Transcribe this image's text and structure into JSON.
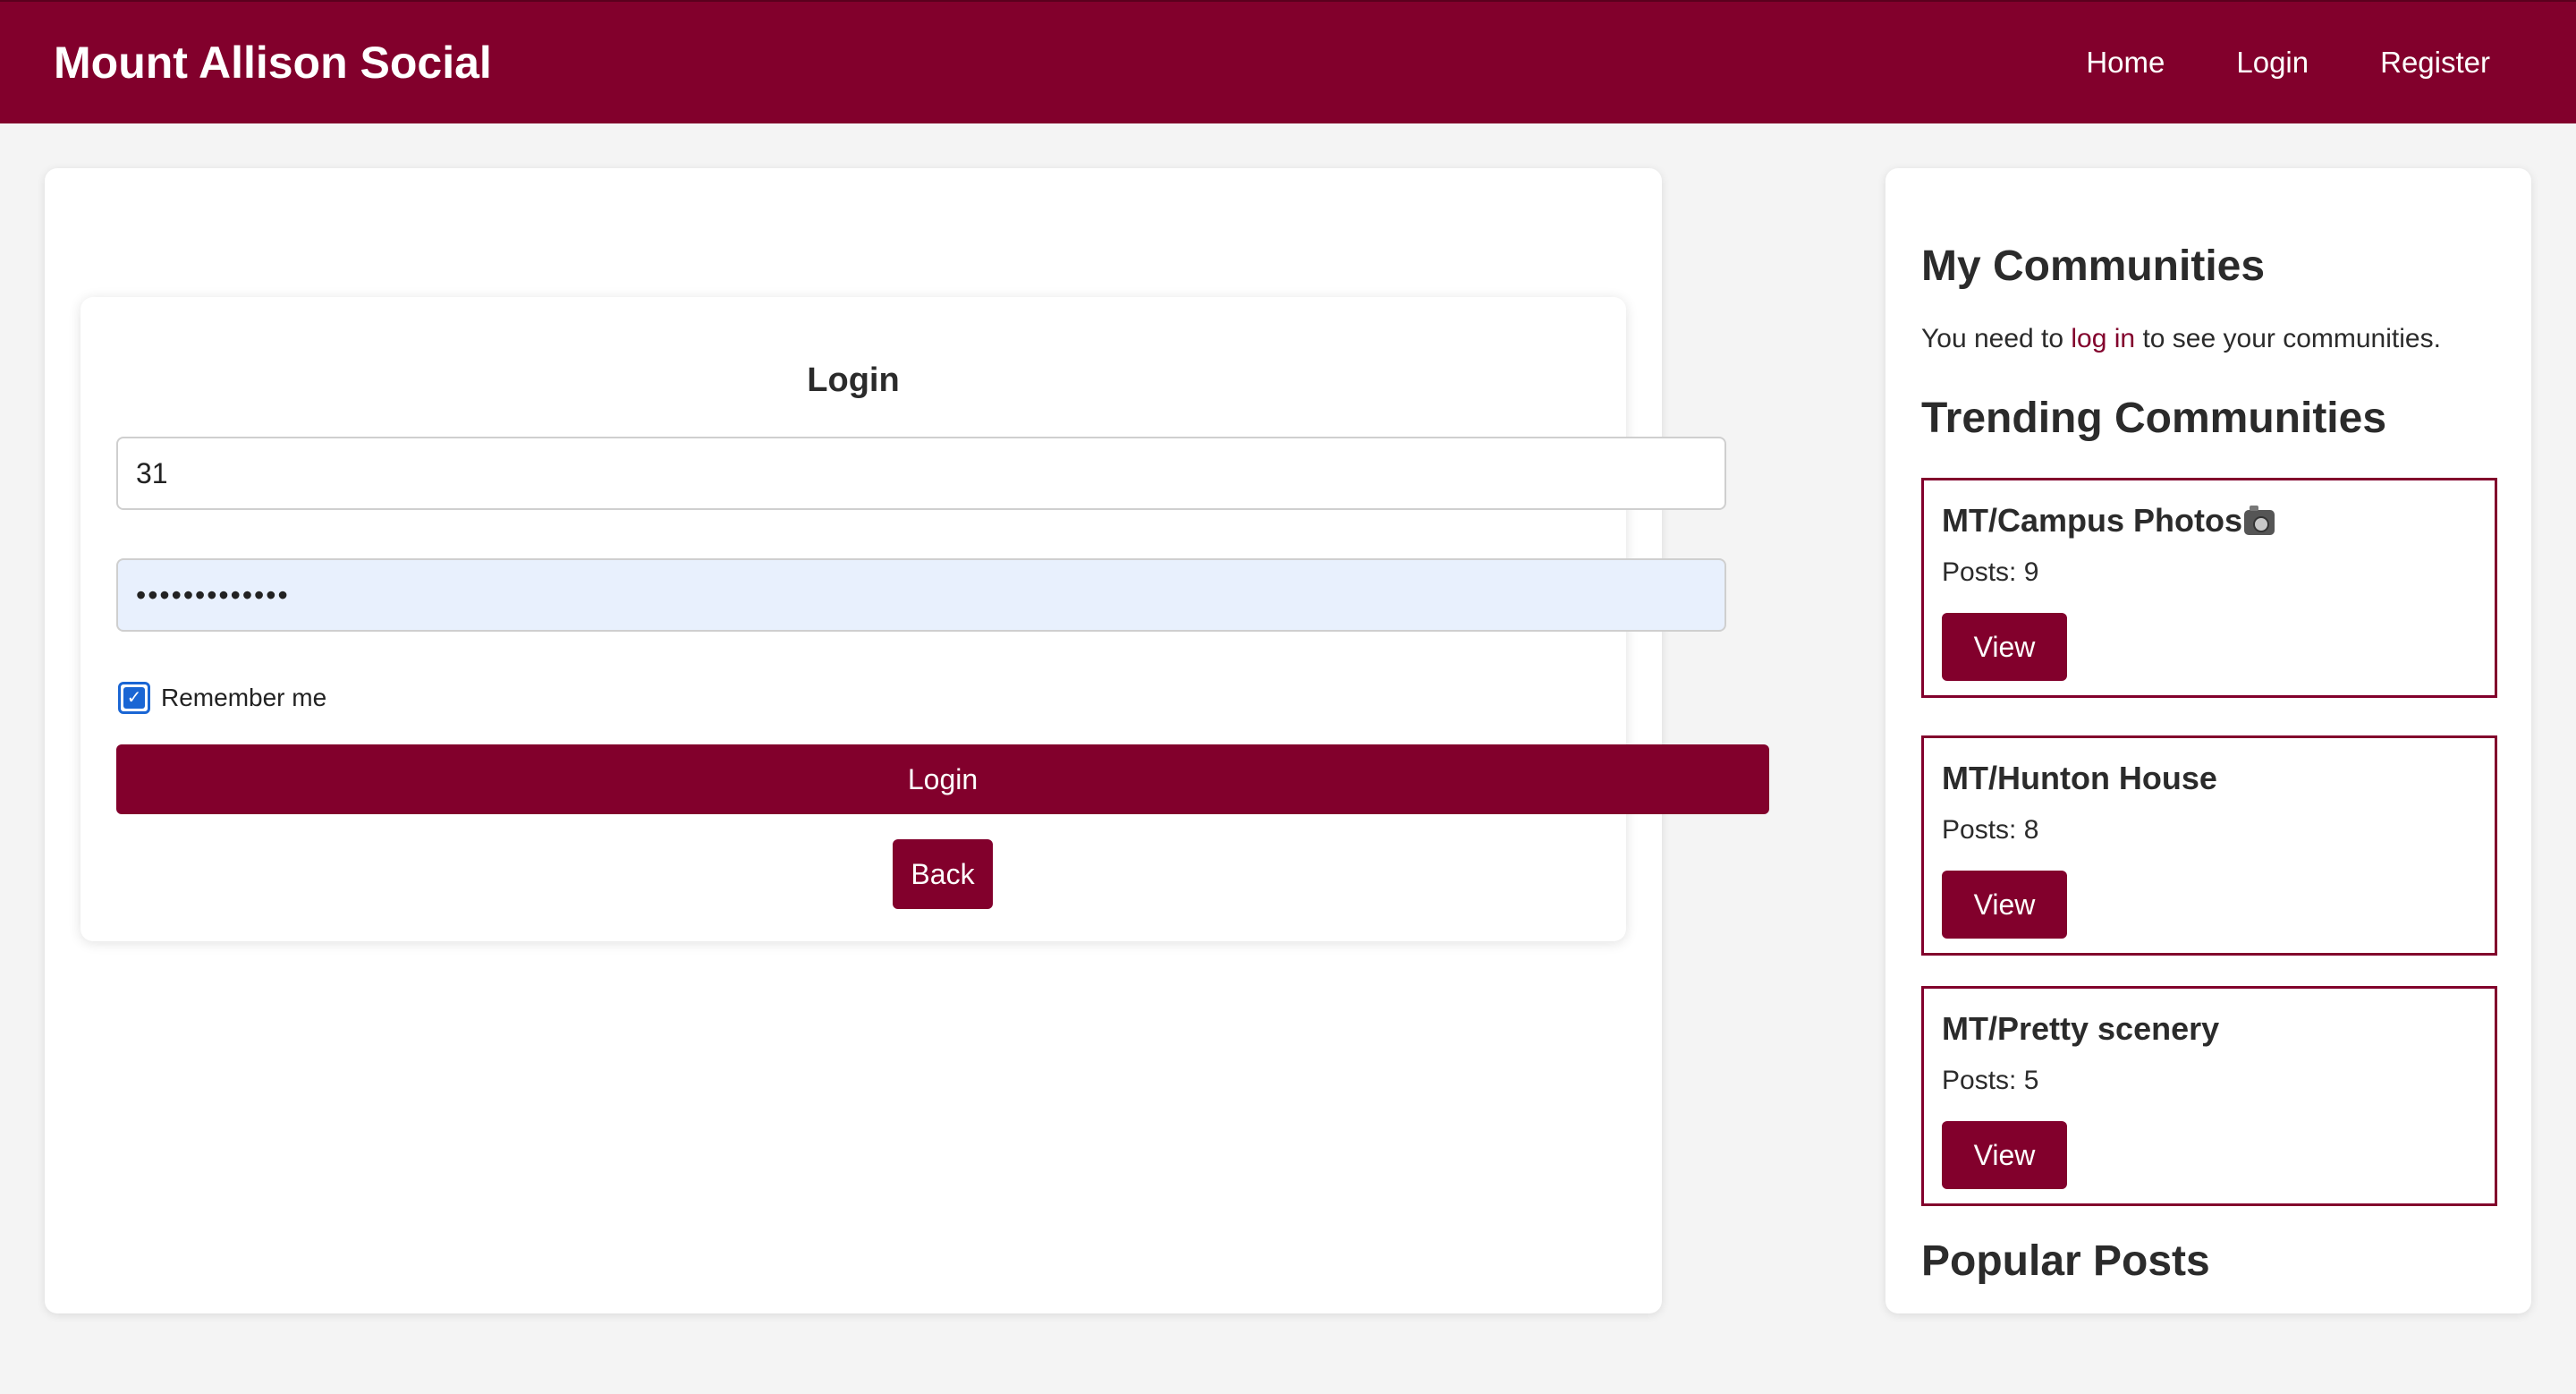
{
  "header": {
    "brand": "Mount Allison Social",
    "nav": [
      "Home",
      "Login",
      "Register"
    ]
  },
  "login": {
    "title": "Login",
    "username_value": "31",
    "password_value": "•••••••••••••",
    "remember_label": "Remember me",
    "remember_checked": true,
    "login_button": "Login",
    "back_button": "Back"
  },
  "sidebar": {
    "my_communities_title": "My Communities",
    "login_prompt_before": "You need to ",
    "login_prompt_link": "log in",
    "login_prompt_after": " to see your communities.",
    "trending_title": "Trending Communities",
    "communities": [
      {
        "name": "MT/Campus Photos",
        "icon": "camera-icon",
        "posts": "Posts: 9",
        "button": "View"
      },
      {
        "name": "MT/Hunton House",
        "posts": "Posts: 8",
        "button": "View"
      },
      {
        "name": "MT/Pretty scenery",
        "posts": "Posts: 5",
        "button": "View"
      }
    ],
    "popular_title": "Popular Posts"
  },
  "colors": {
    "brand": "#82002c",
    "background": "#f4f4f4",
    "input_autofill": "#e8f0fd",
    "checkbox": "#1a66d4"
  }
}
